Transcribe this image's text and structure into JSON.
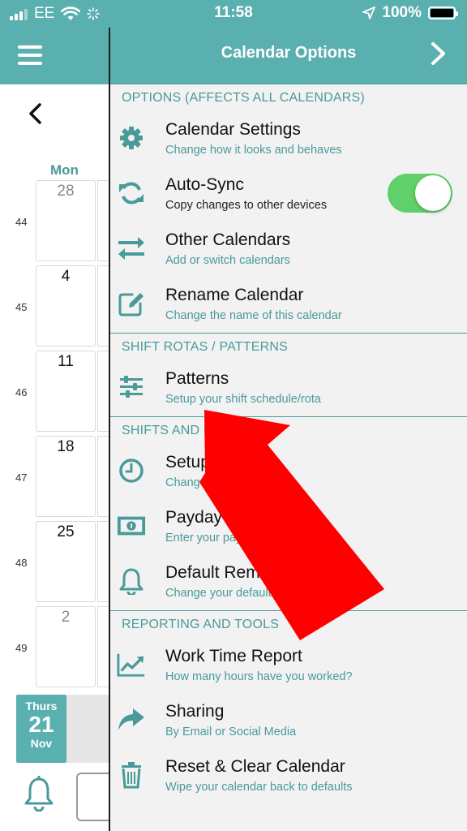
{
  "status": {
    "carrier": "EE",
    "time": "11:58",
    "battery": "100%"
  },
  "calendar": {
    "weekday_label": "Mon",
    "weeks": [
      {
        "week": "44",
        "day": "28",
        "muted": true
      },
      {
        "week": "45",
        "day": "4",
        "muted": false
      },
      {
        "week": "46",
        "day": "11",
        "muted": false
      },
      {
        "week": "47",
        "day": "18",
        "muted": false
      },
      {
        "week": "48",
        "day": "25",
        "muted": false
      },
      {
        "week": "49",
        "day": "2",
        "muted": true
      }
    ],
    "today": {
      "dow": "Thurs",
      "day": "21",
      "month": "Nov"
    }
  },
  "drawer": {
    "title": "Calendar Options",
    "sections": [
      {
        "heading": "OPTIONS (AFFECTS ALL CALENDARS)",
        "items": [
          {
            "title": "Calendar Settings",
            "subtitle": "Change how it looks and behaves"
          },
          {
            "title": "Auto-Sync",
            "subtitle": "Copy changes to other devices",
            "toggle": true
          },
          {
            "title": "Other Calendars",
            "subtitle": "Add or switch calendars"
          },
          {
            "title": "Rename Calendar",
            "subtitle": "Change the name of this calendar"
          }
        ]
      },
      {
        "heading": "SHIFT ROTAS / PATTERNS",
        "items": [
          {
            "title": "Patterns",
            "subtitle": "Setup your shift schedule/rota"
          }
        ]
      },
      {
        "heading": "SHIFTS AND DE",
        "items": [
          {
            "title": "Setup S",
            "subtitle": "Change colo                   nd times"
          },
          {
            "title": "Payday Se",
            "subtitle": "Enter your payday"
          },
          {
            "title": "Default Remi",
            "subtitle": "Change your default                       s"
          }
        ]
      },
      {
        "heading": "REPORTING AND TOOLS",
        "items": [
          {
            "title": "Work Time Report",
            "subtitle": "How many hours have you worked?"
          },
          {
            "title": "Sharing",
            "subtitle": "By Email or Social Media"
          },
          {
            "title": "Reset & Clear Calendar",
            "subtitle": "Wipe your calendar back to defaults"
          }
        ]
      }
    ]
  },
  "colors": {
    "teal": "#5aafaf",
    "teal_text": "#4a9a9a",
    "toggle_on": "#5fd06a",
    "annotation_arrow": "#ff0000"
  },
  "auto_sync_enabled": true
}
